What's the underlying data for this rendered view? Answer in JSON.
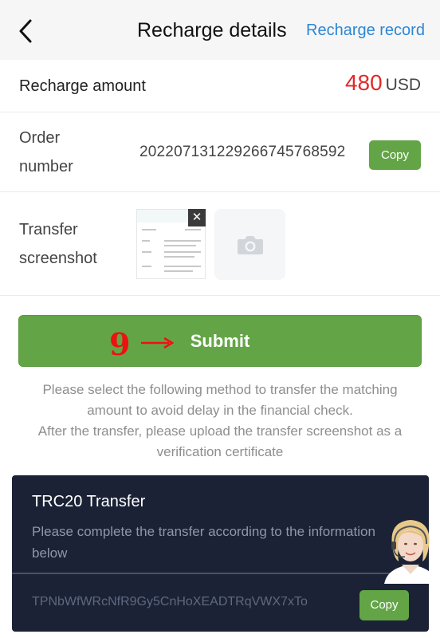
{
  "header": {
    "title": "Recharge details",
    "link": "Recharge record",
    "back_icon": "chevron-left-icon"
  },
  "amount": {
    "label": "Recharge amount",
    "value": "480",
    "unit": "USD",
    "value_color": "#e02a2a"
  },
  "order": {
    "label": "Order number",
    "number": "20220713122926674576859​2",
    "copy_label": "Copy"
  },
  "screenshot": {
    "label": "Transfer screenshot",
    "close_glyph": "✕",
    "upload_icon": "camera-icon"
  },
  "annotation": {
    "step": "9",
    "arrow_icon": "arrow-right-icon"
  },
  "submit_label": "Submit",
  "notice": {
    "line1": "Please select the following method to transfer the matching amount to avoid delay in the financial check.",
    "line2": "After the transfer, please upload the transfer screenshot as a verification certificate"
  },
  "transfer": {
    "title": "TRC20 Transfer",
    "desc": "Please complete the transfer according to the information below",
    "address": "TPNbWfWRcNfR9Gy5CnHoXEADTRqVWX7xTo",
    "copy_label": "Copy"
  },
  "support_icon": "customer-service-avatar-icon",
  "colors": {
    "accent_green": "#63a546",
    "link_blue": "#2b86d6",
    "panel_bg": "#1b2236"
  }
}
